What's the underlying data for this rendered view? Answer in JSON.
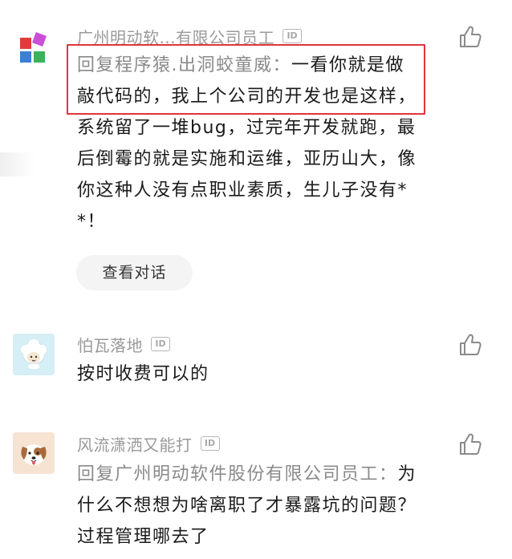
{
  "comments": [
    {
      "username": "广州明动软...有限公司员工",
      "id_badge": "ID",
      "reply_prefix": "回复程序猿.出洞蛟童威：",
      "text": "一看你就是做敲代码的，我上个公司的开发也是这样，系统留了一堆bug，过完年开发就跑，最后倒霉的就是实施和运维，亚历山大，像你这种人没有点职业素质，生儿子没有**！",
      "view_dialog_label": "查看对话"
    },
    {
      "username": "怕瓦落地",
      "id_badge": "ID",
      "text": "按时收费可以的"
    },
    {
      "username": "风流潇洒又能打",
      "id_badge": "ID",
      "reply_prefix": "回复广州明动软件股份有限公司员工：",
      "text": "为什么不想想为啥离职了才暴露坑的问题？过程管理哪去了"
    }
  ],
  "colors": {
    "highlight_border": "#e0353b",
    "username": "#9a9a9a",
    "text": "#1a1a1a"
  },
  "icons": {
    "like": "thumbs-up-icon",
    "avatar1": "colorful-blocks-logo",
    "avatar2": "sheep-icon",
    "avatar3": "dog-icon"
  }
}
